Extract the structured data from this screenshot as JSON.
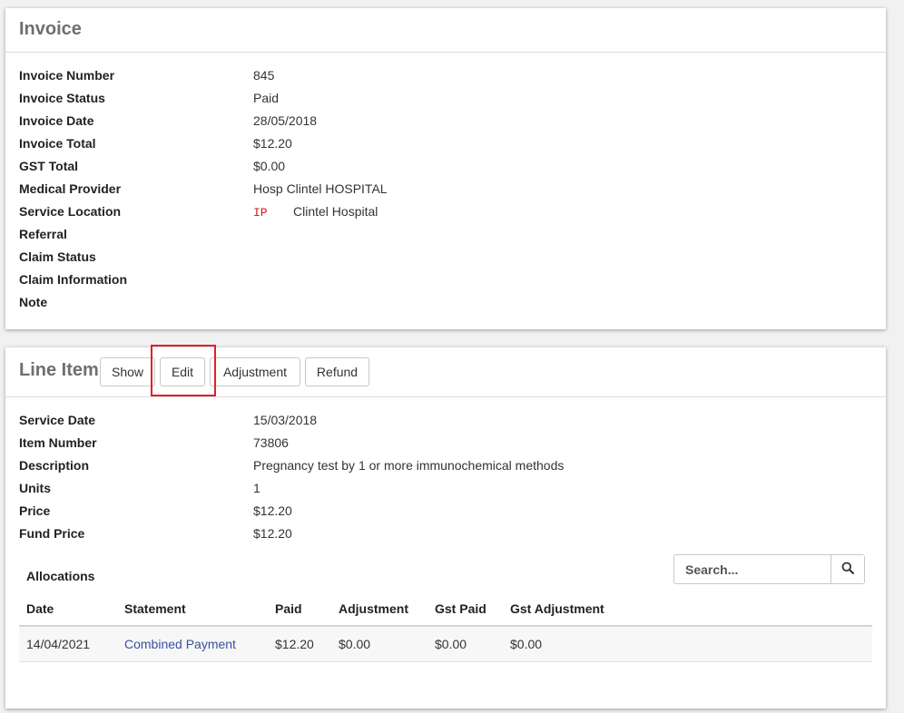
{
  "invoice": {
    "title": "Invoice",
    "fields": [
      {
        "label": "Invoice Number",
        "value": "845"
      },
      {
        "label": "Invoice Status",
        "value": "Paid"
      },
      {
        "label": "Invoice Date",
        "value": "28/05/2018"
      },
      {
        "label": "Invoice Total",
        "value": "$12.20"
      },
      {
        "label": "GST Total",
        "value": "$0.00"
      },
      {
        "label": "Medical Provider",
        "value": "Hosp Clintel HOSPITAL"
      },
      {
        "label": "Service Location",
        "code": "IP",
        "value": "Clintel Hospital"
      },
      {
        "label": "Referral",
        "value": ""
      },
      {
        "label": "Claim Status",
        "value": ""
      },
      {
        "label": "Claim Information",
        "value": ""
      },
      {
        "label": "Note",
        "value": ""
      }
    ]
  },
  "line_item": {
    "title": "Line Item",
    "buttons": {
      "show": "Show",
      "edit": "Edit",
      "adjustment": "Adjustment",
      "refund": "Refund"
    },
    "fields": [
      {
        "label": "Service Date",
        "value": "15/03/2018"
      },
      {
        "label": "Item Number",
        "value": "73806"
      },
      {
        "label": "Description",
        "value": "Pregnancy test by 1 or more immunochemical methods"
      },
      {
        "label": "Units",
        "value": "1"
      },
      {
        "label": "Price",
        "value": "$12.20"
      },
      {
        "label": "Fund Price",
        "value": "$12.20"
      }
    ],
    "allocations": {
      "label": "Allocations",
      "search_placeholder": "Search...",
      "columns": [
        "Date",
        "Statement",
        "Paid",
        "Adjustment",
        "Gst Paid",
        "Gst Adjustment"
      ],
      "rows": [
        {
          "date": "14/04/2021",
          "statement": "Combined Payment",
          "paid": "$12.20",
          "adjustment": "$0.00",
          "gst_paid": "$0.00",
          "gst_adjustment": "$0.00"
        }
      ]
    }
  },
  "colors": {
    "highlight": "#e0202a",
    "link": "#3a4fa0",
    "code": "#cc1f1f"
  },
  "icons": {
    "search": "search-icon"
  }
}
